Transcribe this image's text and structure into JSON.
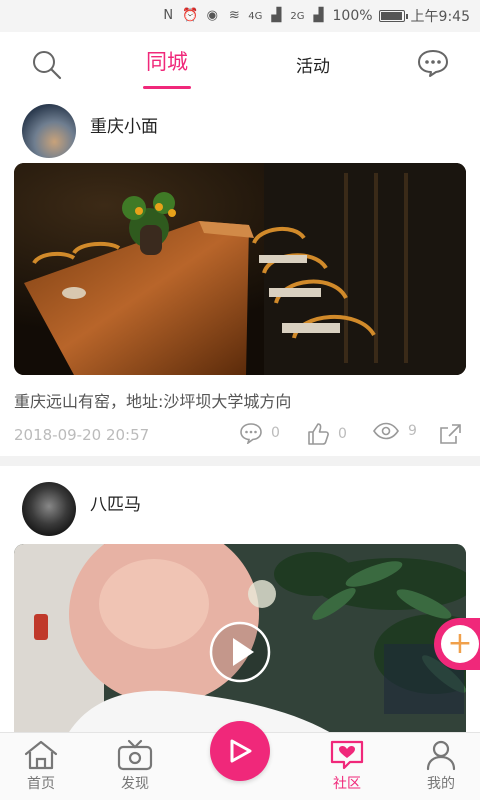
{
  "status_bar": {
    "battery": "100%",
    "time": "上午9:45",
    "net1": "4G",
    "net2": "2G",
    "battery_level": 1.0
  },
  "top_nav": {
    "tabs": [
      {
        "label": "同城",
        "active": true
      },
      {
        "label": "活动",
        "active": false
      }
    ],
    "accent_color": "#f0287a"
  },
  "posts": [
    {
      "author": "重庆小面",
      "caption": "重庆远山有窑，地址:沙坪坝大学城方向",
      "date": "2018-09-20 20:57",
      "comments": "0",
      "likes": "0",
      "views": "9"
    },
    {
      "author": "八匹马"
    }
  ],
  "bottom_nav": {
    "items": [
      {
        "label": "首页",
        "icon": "home-icon"
      },
      {
        "label": "发现",
        "icon": "tv-icon"
      },
      {
        "label": "社区",
        "icon": "heart-chat-icon",
        "active": true
      },
      {
        "label": "我的",
        "icon": "person-icon"
      }
    ]
  }
}
